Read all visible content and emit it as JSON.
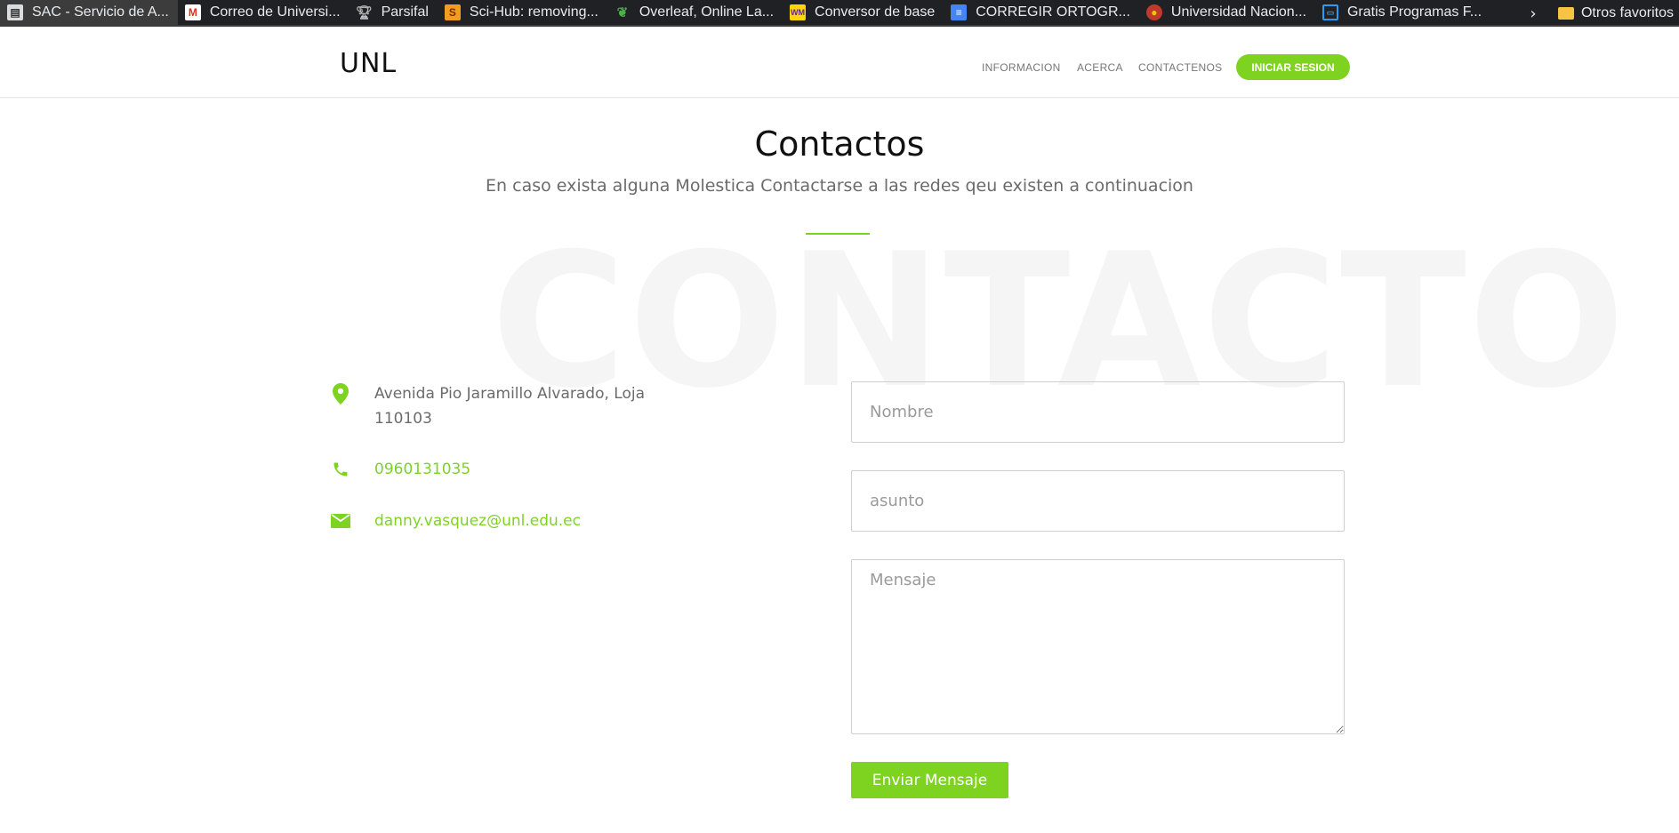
{
  "bookmarks": [
    {
      "label": "SAC - Servicio de A...",
      "icon": "document-icon",
      "active": true
    },
    {
      "label": "Correo de Universi...",
      "icon": "gmail-icon"
    },
    {
      "label": "Parsifal",
      "icon": "trophy-icon"
    },
    {
      "label": "Sci-Hub: removing...",
      "icon": "scihub-icon"
    },
    {
      "label": "Overleaf, Online La...",
      "icon": "overleaf-icon"
    },
    {
      "label": "Conversor de base",
      "icon": "conversor-icon"
    },
    {
      "label": "CORREGIR ORTOGR...",
      "icon": "docs-icon"
    },
    {
      "label": "Universidad Nacion...",
      "icon": "university-icon"
    },
    {
      "label": "Gratis Programas F...",
      "icon": "tv-icon"
    }
  ],
  "bookmarks_more": "Otros favoritos",
  "header": {
    "logo": "UNL",
    "nav": [
      "INFORMACION",
      "ACERCA",
      "CONTACTENOS"
    ],
    "login": "INICIAR SESION"
  },
  "main": {
    "title": "Contactos",
    "subtitle": "En caso exista alguna Molestica Contactarse a las redes qeu existen a continuacion",
    "watermark": "CONTACTO"
  },
  "contact": {
    "address": "Avenida Pio Jaramillo Alvarado, Loja 110103",
    "phone": "0960131035",
    "email": "danny.vasquez@unl.edu.ec"
  },
  "form": {
    "name_placeholder": "Nombre",
    "subject_placeholder": "asunto",
    "message_placeholder": "Mensaje",
    "submit": "Enviar Mensaje"
  },
  "colors": {
    "accent": "#7ed321",
    "bookmarks_bar": "#202124"
  }
}
